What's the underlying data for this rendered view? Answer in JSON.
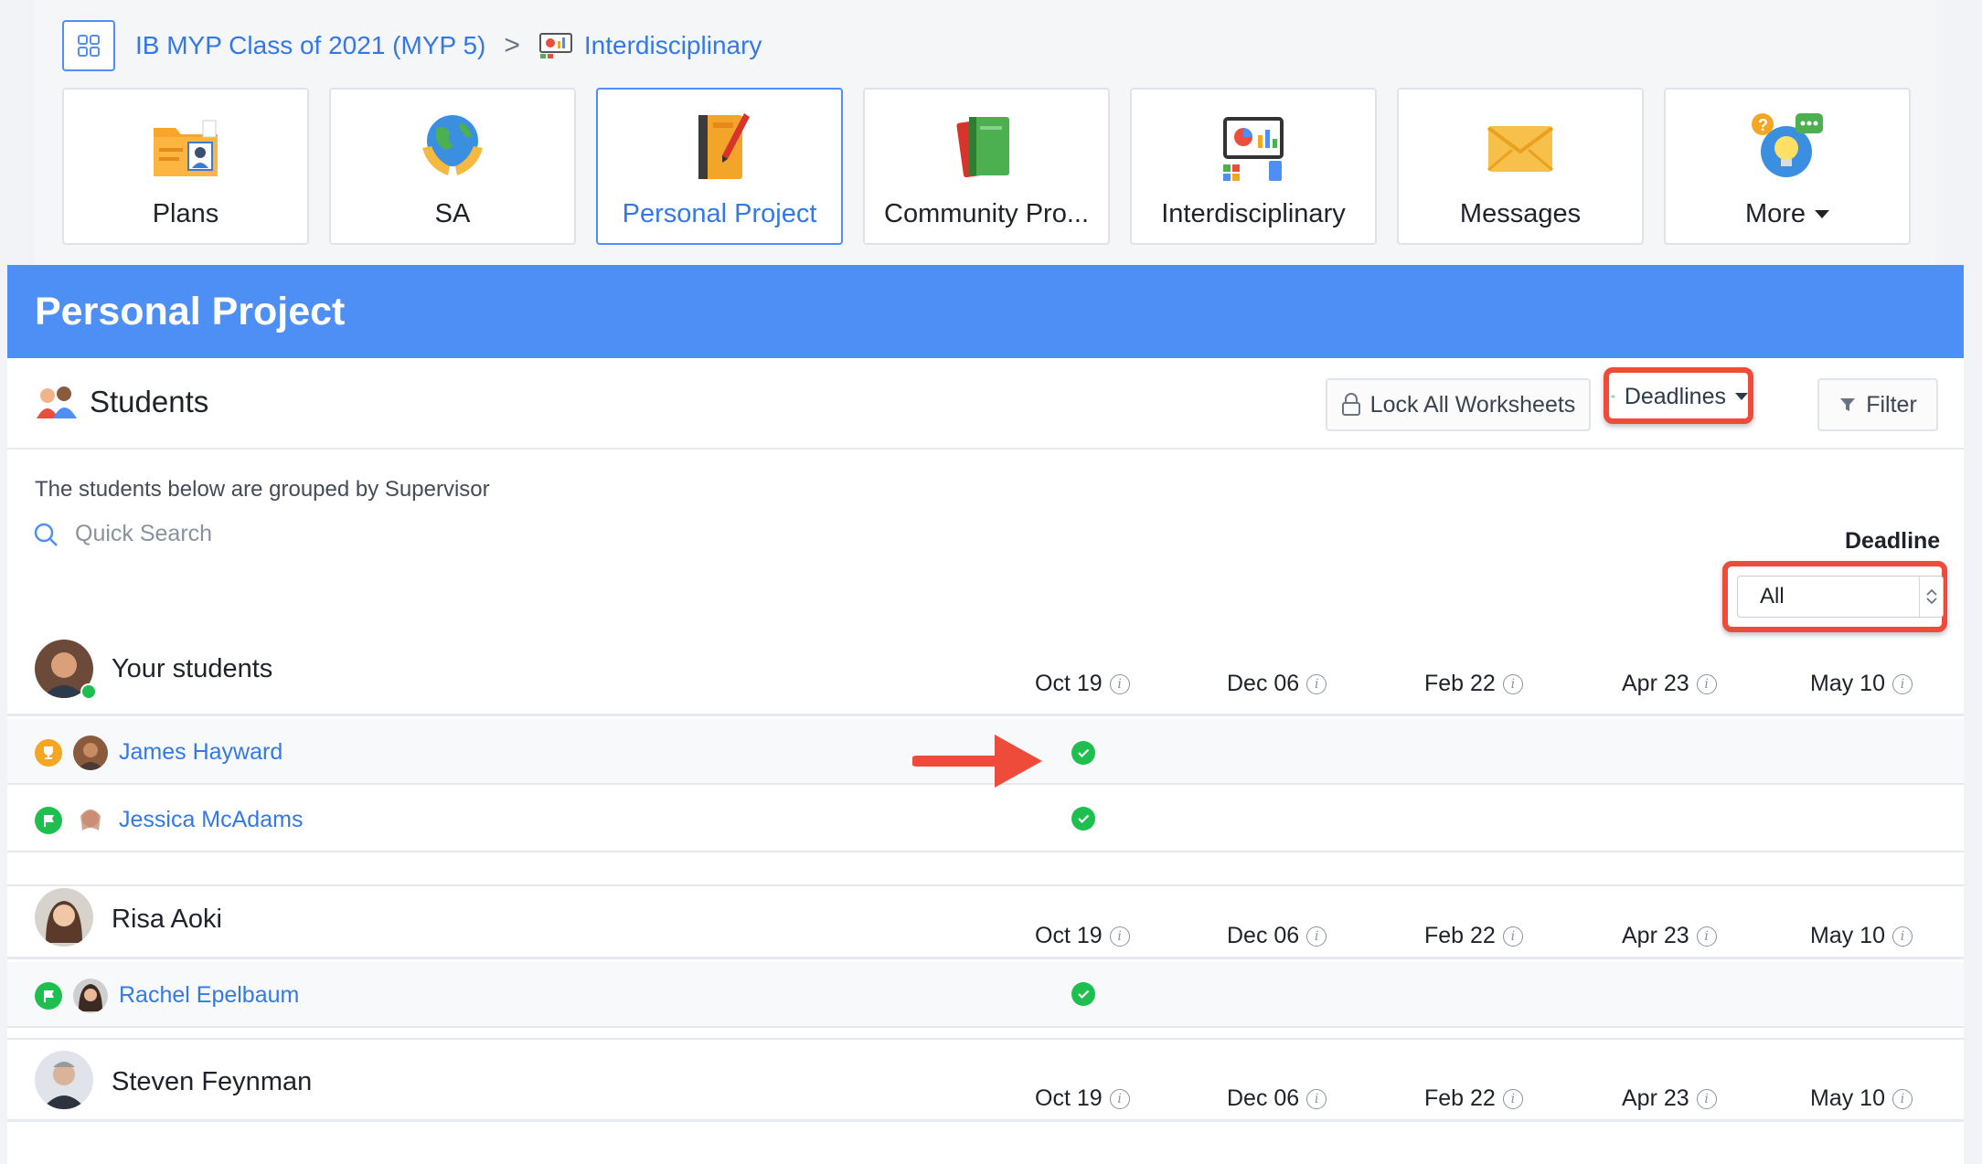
{
  "breadcrumb": {
    "class_name": "IB MYP Class of 2021 (MYP 5)",
    "separator": ">",
    "current": "Interdisciplinary"
  },
  "tiles": [
    {
      "label": "Plans",
      "icon": "folder-icon",
      "active": false
    },
    {
      "label": "SA",
      "icon": "globe-hands-icon",
      "active": false
    },
    {
      "label": "Personal Project",
      "icon": "notebook-icon",
      "active": true
    },
    {
      "label": "Community Pro...",
      "icon": "books-icon",
      "active": false
    },
    {
      "label": "Interdisciplinary",
      "icon": "presentation-icon",
      "active": false
    },
    {
      "label": "Messages",
      "icon": "envelope-icon",
      "active": false
    },
    {
      "label": "More",
      "icon": "lightbulb-chat-icon",
      "active": false
    }
  ],
  "page": {
    "title": "Personal Project"
  },
  "students_section": {
    "title": "Students",
    "lock_label": "Lock All Worksheets",
    "deadlines_label": "Deadlines",
    "filter_label": "Filter",
    "intro": "The students below are grouped by Supervisor",
    "search_placeholder": "Quick Search",
    "deadline_label": "Deadline",
    "deadline_value": "All"
  },
  "deadline_columns": [
    "Oct 19",
    "Dec 06",
    "Feb 22",
    "Apr 23",
    "May 10"
  ],
  "groups": [
    {
      "supervisor": "Your students",
      "online": true,
      "students": [
        {
          "name": "James Hayward",
          "status": "trophy",
          "oct19_done": true
        },
        {
          "name": "Jessica McAdams",
          "status": "flag",
          "oct19_done": true
        }
      ]
    },
    {
      "supervisor": "Risa Aoki",
      "online": false,
      "students": [
        {
          "name": "Rachel Epelbaum",
          "status": "flag",
          "oct19_done": true
        }
      ]
    },
    {
      "supervisor": "Steven Feynman",
      "online": false,
      "students": []
    }
  ],
  "colors": {
    "accent": "#4e8ff5",
    "link": "#3478e8",
    "highlight": "#ee4b3b",
    "success": "#1fbf4f",
    "trophy": "#f5a623"
  }
}
